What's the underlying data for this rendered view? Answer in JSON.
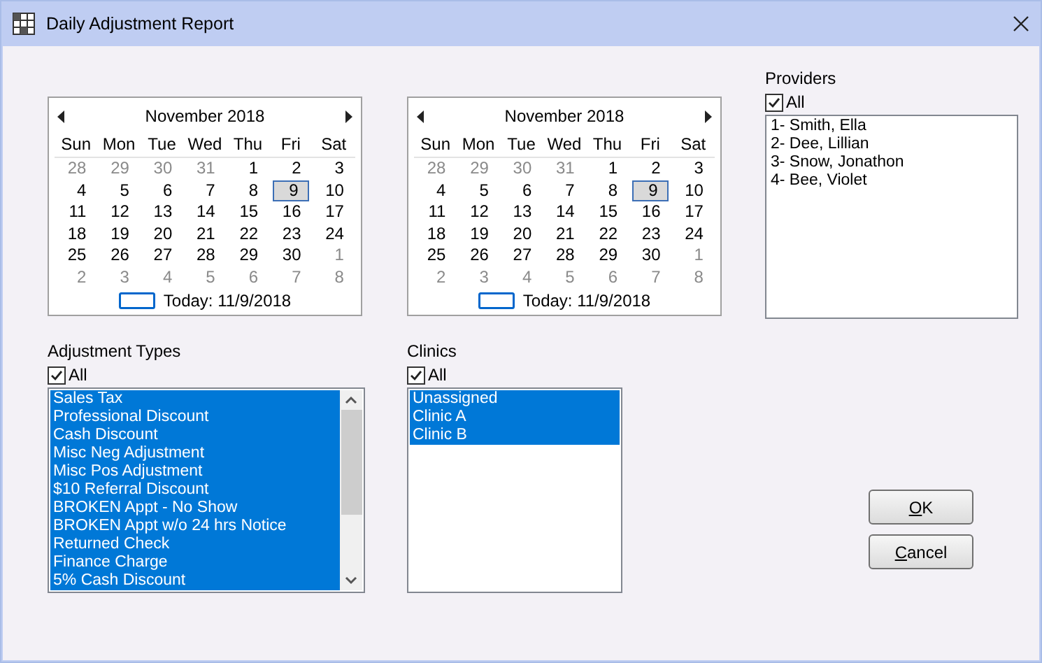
{
  "window": {
    "title": "Daily Adjustment Report"
  },
  "calendars": [
    {
      "month": "November 2018",
      "weekdays": [
        "Sun",
        "Mon",
        "Tue",
        "Wed",
        "Thu",
        "Fri",
        "Sat"
      ],
      "weeks": [
        [
          {
            "day": "28",
            "dimmed": true,
            "selected": false
          },
          {
            "day": "29",
            "dimmed": true,
            "selected": false
          },
          {
            "day": "30",
            "dimmed": true,
            "selected": false
          },
          {
            "day": "31",
            "dimmed": true,
            "selected": false
          },
          {
            "day": "1",
            "dimmed": false,
            "selected": false
          },
          {
            "day": "2",
            "dimmed": false,
            "selected": false
          },
          {
            "day": "3",
            "dimmed": false,
            "selected": false
          }
        ],
        [
          {
            "day": "4",
            "dimmed": false,
            "selected": false
          },
          {
            "day": "5",
            "dimmed": false,
            "selected": false
          },
          {
            "day": "6",
            "dimmed": false,
            "selected": false
          },
          {
            "day": "7",
            "dimmed": false,
            "selected": false
          },
          {
            "day": "8",
            "dimmed": false,
            "selected": false
          },
          {
            "day": "9",
            "dimmed": false,
            "selected": true
          },
          {
            "day": "10",
            "dimmed": false,
            "selected": false
          }
        ],
        [
          {
            "day": "11",
            "dimmed": false,
            "selected": false
          },
          {
            "day": "12",
            "dimmed": false,
            "selected": false
          },
          {
            "day": "13",
            "dimmed": false,
            "selected": false
          },
          {
            "day": "14",
            "dimmed": false,
            "selected": false
          },
          {
            "day": "15",
            "dimmed": false,
            "selected": false
          },
          {
            "day": "16",
            "dimmed": false,
            "selected": false
          },
          {
            "day": "17",
            "dimmed": false,
            "selected": false
          }
        ],
        [
          {
            "day": "18",
            "dimmed": false,
            "selected": false
          },
          {
            "day": "19",
            "dimmed": false,
            "selected": false
          },
          {
            "day": "20",
            "dimmed": false,
            "selected": false
          },
          {
            "day": "21",
            "dimmed": false,
            "selected": false
          },
          {
            "day": "22",
            "dimmed": false,
            "selected": false
          },
          {
            "day": "23",
            "dimmed": false,
            "selected": false
          },
          {
            "day": "24",
            "dimmed": false,
            "selected": false
          }
        ],
        [
          {
            "day": "25",
            "dimmed": false,
            "selected": false
          },
          {
            "day": "26",
            "dimmed": false,
            "selected": false
          },
          {
            "day": "27",
            "dimmed": false,
            "selected": false
          },
          {
            "day": "28",
            "dimmed": false,
            "selected": false
          },
          {
            "day": "29",
            "dimmed": false,
            "selected": false
          },
          {
            "day": "30",
            "dimmed": false,
            "selected": false
          },
          {
            "day": "1",
            "dimmed": true,
            "selected": false
          }
        ],
        [
          {
            "day": "2",
            "dimmed": true,
            "selected": false
          },
          {
            "day": "3",
            "dimmed": true,
            "selected": false
          },
          {
            "day": "4",
            "dimmed": true,
            "selected": false
          },
          {
            "day": "5",
            "dimmed": true,
            "selected": false
          },
          {
            "day": "6",
            "dimmed": true,
            "selected": false
          },
          {
            "day": "7",
            "dimmed": true,
            "selected": false
          },
          {
            "day": "8",
            "dimmed": true,
            "selected": false
          }
        ]
      ],
      "today": "Today: 11/9/2018"
    },
    {
      "month": "November 2018",
      "weekdays": [
        "Sun",
        "Mon",
        "Tue",
        "Wed",
        "Thu",
        "Fri",
        "Sat"
      ],
      "weeks": [
        [
          {
            "day": "28",
            "dimmed": true,
            "selected": false
          },
          {
            "day": "29",
            "dimmed": true,
            "selected": false
          },
          {
            "day": "30",
            "dimmed": true,
            "selected": false
          },
          {
            "day": "31",
            "dimmed": true,
            "selected": false
          },
          {
            "day": "1",
            "dimmed": false,
            "selected": false
          },
          {
            "day": "2",
            "dimmed": false,
            "selected": false
          },
          {
            "day": "3",
            "dimmed": false,
            "selected": false
          }
        ],
        [
          {
            "day": "4",
            "dimmed": false,
            "selected": false
          },
          {
            "day": "5",
            "dimmed": false,
            "selected": false
          },
          {
            "day": "6",
            "dimmed": false,
            "selected": false
          },
          {
            "day": "7",
            "dimmed": false,
            "selected": false
          },
          {
            "day": "8",
            "dimmed": false,
            "selected": false
          },
          {
            "day": "9",
            "dimmed": false,
            "selected": true
          },
          {
            "day": "10",
            "dimmed": false,
            "selected": false
          }
        ],
        [
          {
            "day": "11",
            "dimmed": false,
            "selected": false
          },
          {
            "day": "12",
            "dimmed": false,
            "selected": false
          },
          {
            "day": "13",
            "dimmed": false,
            "selected": false
          },
          {
            "day": "14",
            "dimmed": false,
            "selected": false
          },
          {
            "day": "15",
            "dimmed": false,
            "selected": false
          },
          {
            "day": "16",
            "dimmed": false,
            "selected": false
          },
          {
            "day": "17",
            "dimmed": false,
            "selected": false
          }
        ],
        [
          {
            "day": "18",
            "dimmed": false,
            "selected": false
          },
          {
            "day": "19",
            "dimmed": false,
            "selected": false
          },
          {
            "day": "20",
            "dimmed": false,
            "selected": false
          },
          {
            "day": "21",
            "dimmed": false,
            "selected": false
          },
          {
            "day": "22",
            "dimmed": false,
            "selected": false
          },
          {
            "day": "23",
            "dimmed": false,
            "selected": false
          },
          {
            "day": "24",
            "dimmed": false,
            "selected": false
          }
        ],
        [
          {
            "day": "25",
            "dimmed": false,
            "selected": false
          },
          {
            "day": "26",
            "dimmed": false,
            "selected": false
          },
          {
            "day": "27",
            "dimmed": false,
            "selected": false
          },
          {
            "day": "28",
            "dimmed": false,
            "selected": false
          },
          {
            "day": "29",
            "dimmed": false,
            "selected": false
          },
          {
            "day": "30",
            "dimmed": false,
            "selected": false
          },
          {
            "day": "1",
            "dimmed": true,
            "selected": false
          }
        ],
        [
          {
            "day": "2",
            "dimmed": true,
            "selected": false
          },
          {
            "day": "3",
            "dimmed": true,
            "selected": false
          },
          {
            "day": "4",
            "dimmed": true,
            "selected": false
          },
          {
            "day": "5",
            "dimmed": true,
            "selected": false
          },
          {
            "day": "6",
            "dimmed": true,
            "selected": false
          },
          {
            "day": "7",
            "dimmed": true,
            "selected": false
          },
          {
            "day": "8",
            "dimmed": true,
            "selected": false
          }
        ]
      ],
      "today": "Today: 11/9/2018"
    }
  ],
  "providers": {
    "label": "Providers",
    "all": {
      "label": "All",
      "checked": true
    },
    "items": [
      {
        "text": "1- Smith, Ella",
        "selected": false
      },
      {
        "text": "2- Dee, Lillian",
        "selected": false
      },
      {
        "text": "3- Snow, Jonathon",
        "selected": false
      },
      {
        "text": "4- Bee, Violet",
        "selected": false
      }
    ]
  },
  "adjustment_types": {
    "label": "Adjustment Types",
    "all": {
      "label": "All",
      "checked": true
    },
    "items": [
      {
        "text": "Sales Tax",
        "selected": true
      },
      {
        "text": "Professional Discount",
        "selected": true
      },
      {
        "text": "Cash Discount",
        "selected": true
      },
      {
        "text": "Misc Neg Adjustment",
        "selected": true
      },
      {
        "text": "Misc Pos Adjustment",
        "selected": true
      },
      {
        "text": "$10 Referral Discount",
        "selected": true
      },
      {
        "text": "BROKEN Appt - No Show",
        "selected": true
      },
      {
        "text": "BROKEN Appt w/o 24 hrs Notice",
        "selected": true
      },
      {
        "text": "Returned Check",
        "selected": true
      },
      {
        "text": "Finance Charge",
        "selected": true
      },
      {
        "text": "5% Cash Discount",
        "selected": true
      }
    ]
  },
  "clinics": {
    "label": "Clinics",
    "all": {
      "label": "All",
      "checked": true
    },
    "items": [
      {
        "text": "Unassigned",
        "selected": true
      },
      {
        "text": "Clinic A",
        "selected": true
      },
      {
        "text": "Clinic B",
        "selected": true
      }
    ]
  },
  "buttons": [
    "OK",
    "Cancel"
  ]
}
